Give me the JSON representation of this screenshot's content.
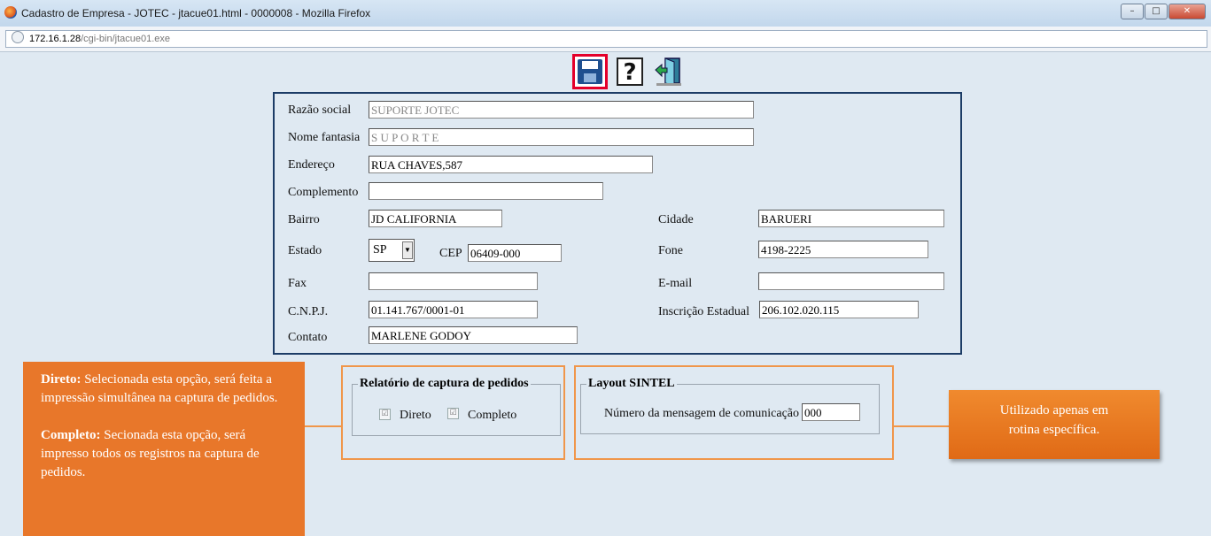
{
  "window": {
    "title": "Cadastro de Empresa - JOTEC - jtacue01.html - 0000008 - Mozilla Firefox"
  },
  "address": {
    "host": "172.16.1.28",
    "path": "/cgi-bin/jtacue01.exe"
  },
  "toolbar": {
    "save_icon": "save-disk-icon",
    "help_icon": "help-icon",
    "exit_icon": "exit-door-icon"
  },
  "form": {
    "razao_social": {
      "label": "Razão social",
      "value": "SUPORTE  JOTEC"
    },
    "nome_fantasia": {
      "label": "Nome fantasia",
      "value": "S U P O R T E"
    },
    "endereco": {
      "label": "Endereço",
      "value": "RUA CHAVES,587"
    },
    "complemento": {
      "label": "Complemento",
      "value": ""
    },
    "bairro": {
      "label": "Bairro",
      "value": "JD CALIFORNIA"
    },
    "cidade": {
      "label": "Cidade",
      "value": "BARUERI"
    },
    "estado": {
      "label": "Estado",
      "value": "SP"
    },
    "cep": {
      "label": "CEP",
      "value": "06409-000"
    },
    "fone": {
      "label": "Fone",
      "value": "4198-2225"
    },
    "fax": {
      "label": "Fax",
      "value": ""
    },
    "email": {
      "label": "E-mail",
      "value": ""
    },
    "cnpj": {
      "label": "C.N.P.J.",
      "value": "01.141.767/0001-01"
    },
    "inscricao": {
      "label": "Inscrição Estadual",
      "value": "206.102.020.115"
    },
    "contato": {
      "label": "Contato",
      "value": "MARLENE GODOY"
    }
  },
  "relatorio": {
    "legend": "Relatório de captura de pedidos",
    "direto": "Direto",
    "completo": "Completo",
    "check_mark": "☑"
  },
  "sintel": {
    "legend": "Layout SINTEL",
    "label": "Número da mensagem de comunicação",
    "value": "000"
  },
  "callouts": {
    "left": {
      "direto_title": "Direto:",
      "direto_text": " Selecionada esta opção, será feita a impressão simultânea na captura de pedidos.",
      "completo_title": "Completo:",
      "completo_text": " Secionada esta opção, será impresso todos os registros na captura de pedidos."
    },
    "right": "Utilizado apenas em rotina específica."
  },
  "colors": {
    "accent_orange": "#e8772a",
    "frame_navy": "#1c3c66",
    "highlight_red": "#e4002b"
  }
}
